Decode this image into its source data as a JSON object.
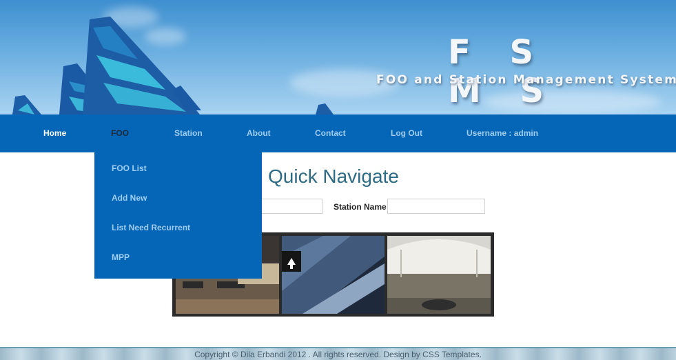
{
  "header": {
    "title": "F S M S",
    "subtitle": "FOO and Station Management System"
  },
  "nav": {
    "items": [
      {
        "label": "Home"
      },
      {
        "label": "FOO"
      },
      {
        "label": "Station"
      },
      {
        "label": "About"
      },
      {
        "label": "Contact"
      },
      {
        "label": "Log Out"
      }
    ],
    "user": "Username : admin"
  },
  "dropdown": {
    "items": [
      {
        "label": "FOO List"
      },
      {
        "label": "Add New"
      },
      {
        "label": "List Need Recurrent"
      },
      {
        "label": "MPP"
      }
    ]
  },
  "main": {
    "title": "Quick Navigate",
    "station_label": "Station Name",
    "foo_input_value": "",
    "station_input_value": ""
  },
  "footer": {
    "text": "Copyright © Dila Erbandi 2012 . All rights reserved. Design by CSS Templates."
  },
  "colors": {
    "nav_bg": "#0566b8",
    "nav_text": "#9fcdf2",
    "title_color": "#2e6b84"
  }
}
